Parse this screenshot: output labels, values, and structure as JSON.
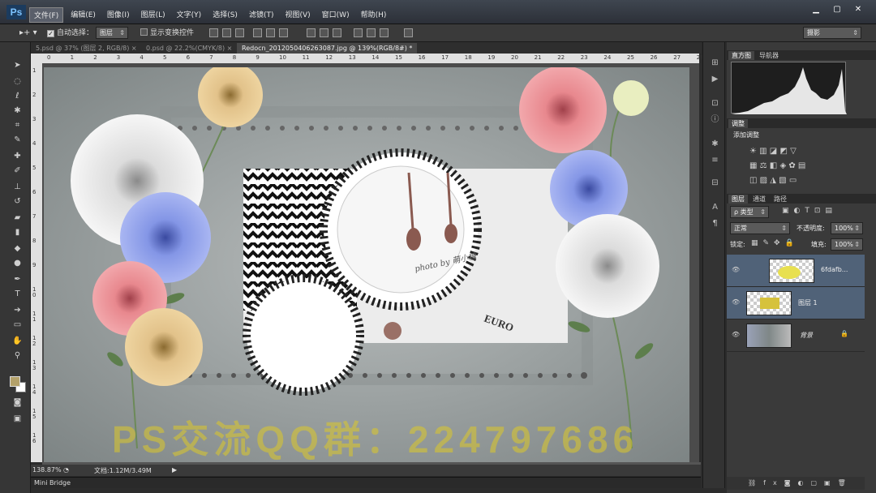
{
  "app": {
    "logo": "Ps"
  },
  "menu": [
    "文件(F)",
    "编辑(E)",
    "图像(I)",
    "图层(L)",
    "文字(Y)",
    "选择(S)",
    "滤镜(T)",
    "视图(V)",
    "窗口(W)",
    "帮助(H)"
  ],
  "window_controls": [
    "▁",
    "▢",
    "✕"
  ],
  "options": {
    "auto_select_label": "自动选择：",
    "auto_select_value": "图层",
    "show_transform_label": "显示变换控件",
    "workspace": "摄影"
  },
  "tabs": [
    {
      "label": "5.psd @ 37% (图层 2, RGB/8)",
      "close": "×"
    },
    {
      "label": "0.psd @ 22.2%(CMYK/8)",
      "close": "×"
    },
    {
      "label": "Redocn_2012050406263087.jpg @ 139%(RGB/8#) *",
      "close": "×"
    }
  ],
  "ruler_h": [
    "0",
    "1",
    "2",
    "3",
    "4",
    "5",
    "6",
    "7",
    "8",
    "9",
    "10",
    "11",
    "12",
    "13",
    "14",
    "15",
    "16",
    "17",
    "18",
    "19",
    "20",
    "21",
    "22",
    "23",
    "24",
    "25",
    "26",
    "27",
    "28"
  ],
  "ruler_v": [
    "1",
    "2",
    "3",
    "4",
    "5",
    "6",
    "7",
    "8",
    "9",
    "1\n0",
    "1\n1",
    "1\n2",
    "1\n3",
    "1\n4",
    "1\n5",
    "1\n6"
  ],
  "image": {
    "photo_by": "photo by 萌小糖",
    "euro_text": "EURO"
  },
  "watermark": "PS交流QQ群：224797686",
  "status": {
    "zoom": "138.87%",
    "doc": "文档:1.12M/3.49M"
  },
  "mini_bridge": "Mini Bridge",
  "panels": {
    "histogram_tabs": [
      "直方图",
      "导航器"
    ],
    "adjust_tabs": [
      "调整"
    ],
    "add_adjustment": "添加调整",
    "layers_tabs": [
      "图层",
      "通道",
      "路径"
    ],
    "filter_kind": "类型",
    "blend_mode": "正常",
    "opacity_label": "不透明度:",
    "opacity": "100%",
    "lock_label": "锁定:",
    "fill_label": "填充:",
    "fill": "100%",
    "layers": [
      {
        "name": "6fdafb..."
      },
      {
        "name": "图层 1"
      },
      {
        "name": "背景"
      }
    ]
  },
  "colors": {
    "fg": "#b3a16a",
    "bg": "#ffffff",
    "accent": "#506278"
  }
}
